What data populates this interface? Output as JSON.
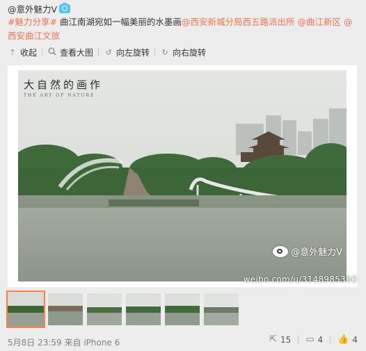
{
  "author": {
    "name": "@意外魅力V"
  },
  "post": {
    "topic": "#魅力分享#",
    "text": " 曲江南湖宛如一幅美丽的水墨画",
    "mention1": "@西安新城分局西五路派出所",
    "mention2": "@曲江新区",
    "mention3": "@西安曲江文旅"
  },
  "toolbar": {
    "collapse": "收起",
    "view_large": "查看大图",
    "rotate_left": "向左旋转",
    "rotate_right": "向右旋转"
  },
  "photo": {
    "title": "大自然的画作",
    "subtitle": "THE ART OF NATURE",
    "watermark_name": "@意外魅力V",
    "watermark_url": "weibo.com/u/3148985360"
  },
  "footer": {
    "date": "5月8日 23:59",
    "source_prefix": "来自",
    "device": "iPhone 6",
    "reposts": "15",
    "comments": "4",
    "likes": "4"
  },
  "colors": {
    "link": "#eb7350",
    "thumb_selected": "#ff8140",
    "camera_badge": "#4fc3f7"
  },
  "icons": [
    "camera-icon",
    "collapse-icon",
    "search-icon",
    "rotate-left-icon",
    "rotate-right-icon",
    "weibo-logo-icon",
    "repost-icon",
    "comment-icon",
    "like-icon"
  ]
}
